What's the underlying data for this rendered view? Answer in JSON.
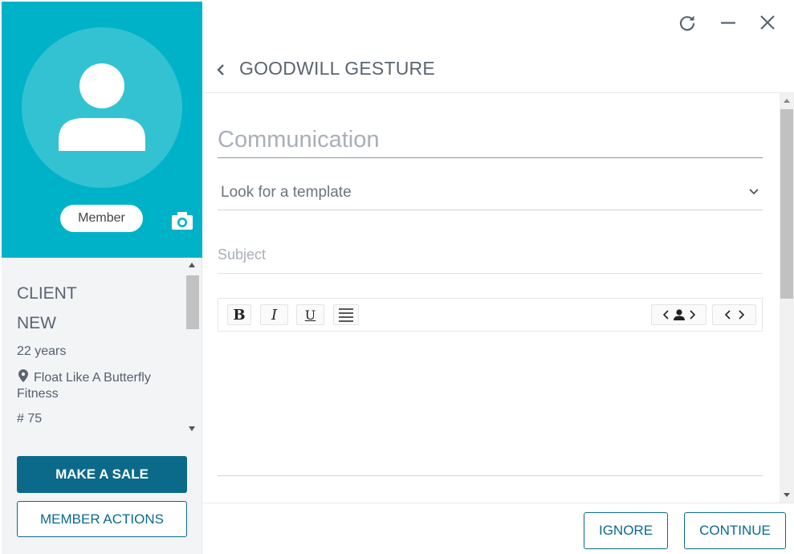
{
  "colors": {
    "accent": "#00b2c7",
    "primary_button": "#0b6a8a",
    "avatar_circle": "#33c2d2"
  },
  "profile": {
    "badge": "Member",
    "status_line1": "CLIENT",
    "status_line2": "NEW",
    "age": "22 years",
    "location": "Float Like A Butterfly Fitness",
    "number": "# 75",
    "icons": [
      "avatar-silhouette-icon",
      "camera-icon",
      "location-pin-icon"
    ]
  },
  "left_actions": {
    "make_sale": "MAKE A SALE",
    "member_actions": "MEMBER ACTIONS"
  },
  "window_controls": [
    "refresh-icon",
    "minimize-icon",
    "close-icon"
  ],
  "header": {
    "title": "GOODWILL GESTURE"
  },
  "form": {
    "section_label": "Communication",
    "template_placeholder": "Look for a template",
    "subject_placeholder": "Subject",
    "toolbar": {
      "bold": "B",
      "italic": "I",
      "underline": "U"
    }
  },
  "footer": {
    "ignore": "IGNORE",
    "continue": "CONTINUE"
  }
}
